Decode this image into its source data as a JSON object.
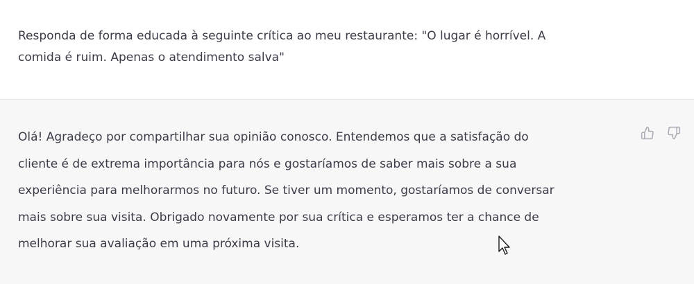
{
  "user_message": {
    "lines": [
      "Responda de forma educada à seguinte crítica ao meu restaurante: \"O lugar é horrível. A",
      "comida é ruim. Apenas o atendimento salva\""
    ]
  },
  "assistant_message": {
    "lines": [
      "Olá! Agradeço por compartilhar sua opinião conosco. Entendemos que a satisfação do",
      "cliente é de extrema importância para nós e gostaríamos de saber mais sobre a sua",
      "experiência para melhorarmos no futuro. Se tiver um momento, gostaríamos de conversar",
      "mais sobre sua visita. Obrigado novamente por sua crítica e esperamos ter a chance de",
      "melhorar sua avaliação em uma próxima visita."
    ]
  },
  "icons": {
    "thumbs_up": "thumbs-up-icon",
    "thumbs_down": "thumbs-down-icon",
    "cursor": "mouse-pointer-icon"
  },
  "colors": {
    "user_bg": "#ffffff",
    "assistant_bg": "#f7f7f8",
    "text": "#3b3c48",
    "icon": "#a9a9b3"
  }
}
